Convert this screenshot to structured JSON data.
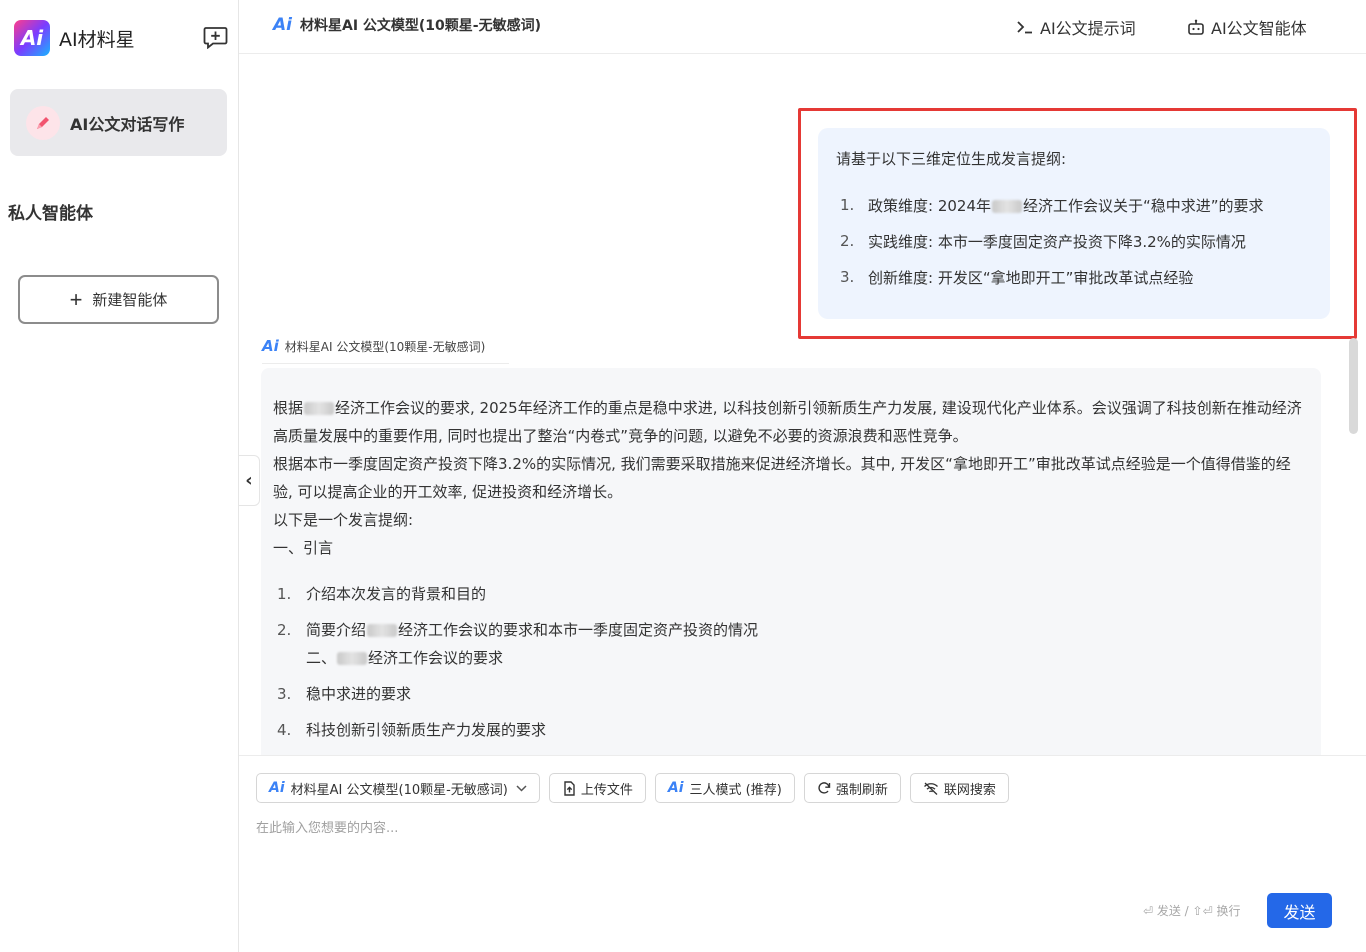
{
  "sidebar": {
    "brand": "AI材料星",
    "logo_text": "Ai",
    "nav_active_label": "AI公文对话写作",
    "section_title": "私人智能体",
    "new_agent_label": "新建智能体"
  },
  "header": {
    "model_label": "材料星AI 公文模型(10颗星-无敏感词)",
    "prompts_label": "AI公文提示词",
    "agents_label": "AI公文智能体"
  },
  "user_message": {
    "intro": "请基于以下三维定位生成发言提纲:",
    "items": [
      {
        "num": "1.",
        "before": "政策维度: 2024年",
        "after": "经济工作会议关于“稳中求进”的要求"
      },
      {
        "num": "2.",
        "text": "实践维度: 本市一季度固定资产投资下降3.2%的实际情况"
      },
      {
        "num": "3.",
        "text": "创新维度: 开发区“拿地即开工”审批改革试点经验"
      }
    ]
  },
  "bot_message": {
    "model_label": "材料星AI 公文模型(10颗星-无敏感词)",
    "p1_before": "根据",
    "p1_after": "经济工作会议的要求, 2025年经济工作的重点是稳中求进, 以科技创新引领新质生产力发展, 建设现代化产业体系。会议强调了科技创新在推动经济高质量发展中的重要作用, 同时也提出了整治“内卷式”竞争的问题, 以避免不必要的资源浪费和恶性竞争。",
    "p2": "根据本市一季度固定资产投资下降3.2%的实际情况, 我们需要采取措施来促进经济增长。其中, 开发区“拿地即开工”审批改革试点经验是一个值得借鉴的经验, 可以提高企业的开工效率, 促进投资和经济增长。",
    "p3": "以下是一个发言提纲:",
    "p4": "一、引言",
    "items": [
      {
        "num": "1.",
        "text": "介绍本次发言的背景和目的"
      },
      {
        "num": "2.",
        "before": "简要介绍",
        "after": "经济工作会议的要求和本市一季度固定资产投资的情况",
        "sub_before": "二、",
        "sub_after": "经济工作会议的要求"
      },
      {
        "num": "3.",
        "text": "稳中求进的要求"
      },
      {
        "num": "4.",
        "text": "科技创新引领新质生产力发展的要求"
      }
    ]
  },
  "composer": {
    "model_select": "材料星AI 公文模型(10颗星-无敏感词)",
    "upload_label": "上传文件",
    "mode_label": "三人模式 (推荐)",
    "refresh_label": "强制刷新",
    "web_search_label": "联网搜索",
    "placeholder": "在此输入您想要的内容...",
    "hint": "⏎ 发送 / ⇧⏎ 换行",
    "send_label": "发送"
  },
  "colors": {
    "accent": "#2468e8",
    "user_bubble": "#eef4fe",
    "highlight_border": "#e53935"
  }
}
